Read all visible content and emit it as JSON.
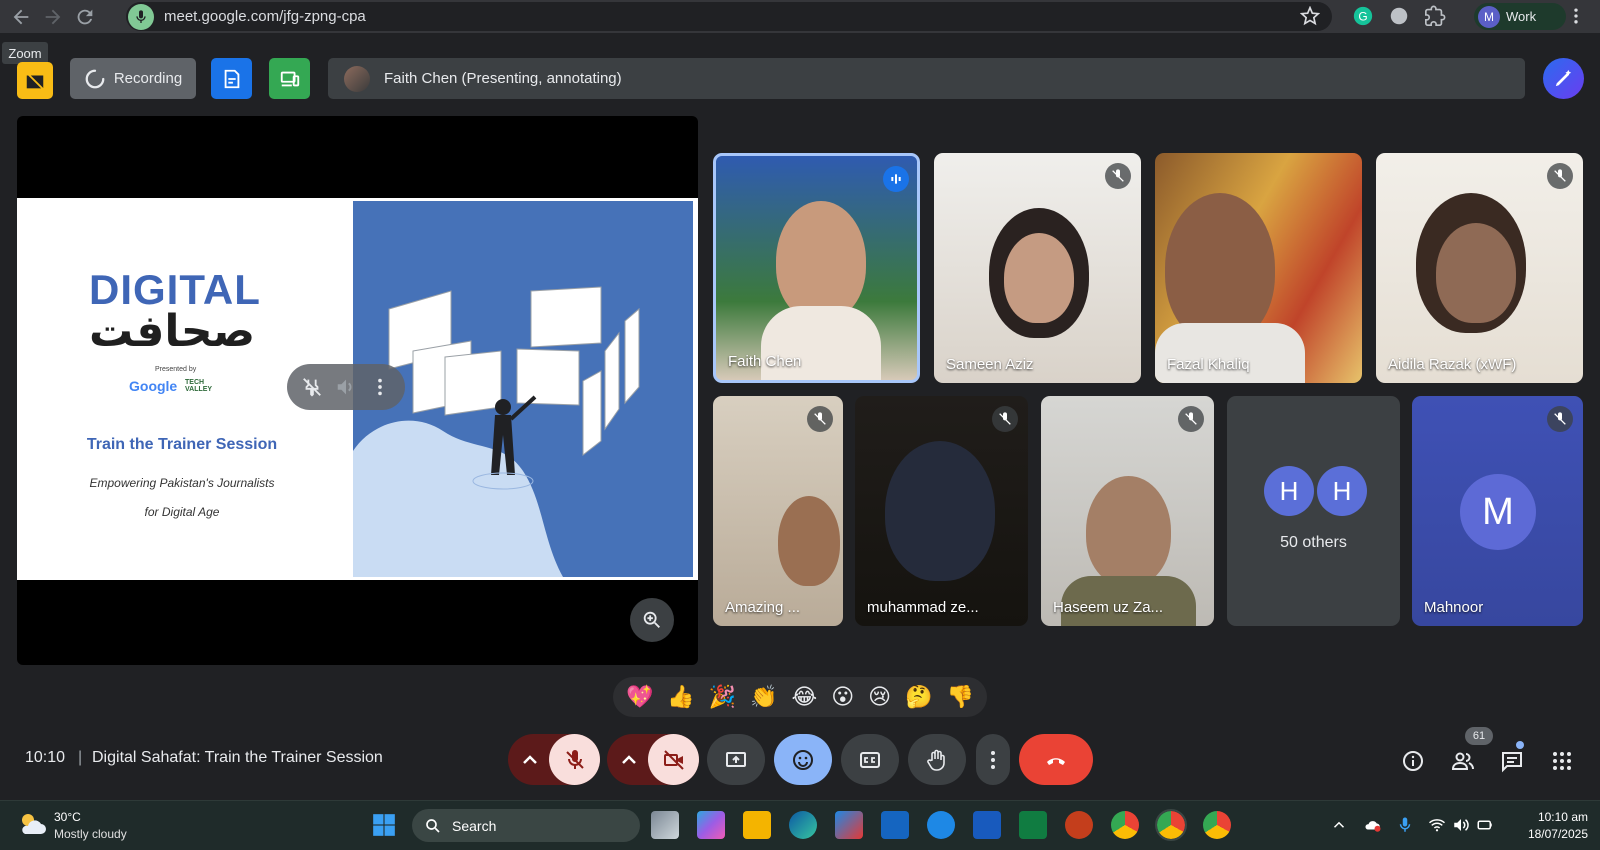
{
  "browser": {
    "url": "meet.google.com/jfg-zpng-cpa",
    "profile_initial": "M",
    "profile_label": "Work",
    "zoom_tooltip": "Zoom"
  },
  "topbar": {
    "recording_label": "Recording",
    "presenter_text": "Faith Chen (Presenting, annotating)"
  },
  "slide": {
    "title_en": "DIGITAL",
    "title_ur": "صحافت",
    "presented_by": "Presented by",
    "google": "Google",
    "techvalley": "TECH VALLEY",
    "heading": "Train the Trainer Session",
    "subtitle_1": "Empowering Pakistan's Journalists",
    "subtitle_2": "for Digital Age"
  },
  "participants": [
    {
      "name": "Faith Chen",
      "state": "speaking"
    },
    {
      "name": "Sameen Aziz",
      "state": "muted"
    },
    {
      "name": "Fazal Khaliq",
      "state": "none"
    },
    {
      "name": "Aidila Razak (xWF)",
      "state": "muted"
    },
    {
      "name": "Amazing ...",
      "state": "muted"
    },
    {
      "name": "muhammad ze...",
      "state": "muted"
    },
    {
      "name": "Haseem uz Za...",
      "state": "muted"
    },
    {
      "name": "Mahnoor",
      "initial": "M",
      "state": "muted"
    }
  ],
  "others_tile": {
    "initial_1": "H",
    "initial_2": "H",
    "label": "50 others"
  },
  "reactions": [
    "💖",
    "👍",
    "🎉",
    "👏",
    "😂",
    "😮",
    "😢",
    "🤔",
    "👎"
  ],
  "meeting": {
    "time": "10:10",
    "separator": "|",
    "title": "Digital Sahafat: Train the Trainer Session",
    "people_count": "61"
  },
  "taskbar": {
    "temperature": "30°C",
    "weather": "Mostly cloudy",
    "search_label": "Search",
    "time": "10:10 am",
    "date": "18/07/2025"
  },
  "colors": {
    "background": "#202124",
    "accent_blue": "#8ab4f8",
    "leave_red": "#ea4335",
    "slide_blue": "#4672b8"
  }
}
